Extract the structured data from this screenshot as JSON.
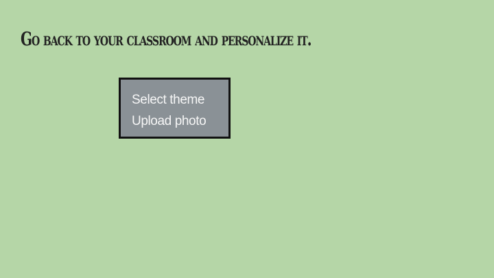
{
  "slide": {
    "title": "Go back to your classroom and personalize it."
  },
  "menu": {
    "items": [
      {
        "label": "Select theme"
      },
      {
        "label": "Upload photo"
      }
    ]
  },
  "colors": {
    "background": "#b5d6a7",
    "menu_background": "#8a9196",
    "menu_border": "#111111",
    "menu_text": "#f6f6f6",
    "title_text": "#222222"
  }
}
